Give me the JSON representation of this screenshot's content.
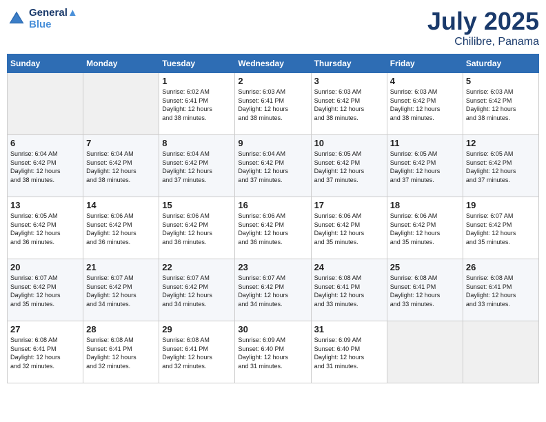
{
  "header": {
    "logo_line1": "General",
    "logo_line2": "Blue",
    "month": "July 2025",
    "location": "Chilibre, Panama"
  },
  "columns": [
    "Sunday",
    "Monday",
    "Tuesday",
    "Wednesday",
    "Thursday",
    "Friday",
    "Saturday"
  ],
  "weeks": [
    [
      {
        "day": "",
        "info": ""
      },
      {
        "day": "",
        "info": ""
      },
      {
        "day": "1",
        "info": "Sunrise: 6:02 AM\nSunset: 6:41 PM\nDaylight: 12 hours\nand 38 minutes."
      },
      {
        "day": "2",
        "info": "Sunrise: 6:03 AM\nSunset: 6:41 PM\nDaylight: 12 hours\nand 38 minutes."
      },
      {
        "day": "3",
        "info": "Sunrise: 6:03 AM\nSunset: 6:42 PM\nDaylight: 12 hours\nand 38 minutes."
      },
      {
        "day": "4",
        "info": "Sunrise: 6:03 AM\nSunset: 6:42 PM\nDaylight: 12 hours\nand 38 minutes."
      },
      {
        "day": "5",
        "info": "Sunrise: 6:03 AM\nSunset: 6:42 PM\nDaylight: 12 hours\nand 38 minutes."
      }
    ],
    [
      {
        "day": "6",
        "info": "Sunrise: 6:04 AM\nSunset: 6:42 PM\nDaylight: 12 hours\nand 38 minutes."
      },
      {
        "day": "7",
        "info": "Sunrise: 6:04 AM\nSunset: 6:42 PM\nDaylight: 12 hours\nand 38 minutes."
      },
      {
        "day": "8",
        "info": "Sunrise: 6:04 AM\nSunset: 6:42 PM\nDaylight: 12 hours\nand 37 minutes."
      },
      {
        "day": "9",
        "info": "Sunrise: 6:04 AM\nSunset: 6:42 PM\nDaylight: 12 hours\nand 37 minutes."
      },
      {
        "day": "10",
        "info": "Sunrise: 6:05 AM\nSunset: 6:42 PM\nDaylight: 12 hours\nand 37 minutes."
      },
      {
        "day": "11",
        "info": "Sunrise: 6:05 AM\nSunset: 6:42 PM\nDaylight: 12 hours\nand 37 minutes."
      },
      {
        "day": "12",
        "info": "Sunrise: 6:05 AM\nSunset: 6:42 PM\nDaylight: 12 hours\nand 37 minutes."
      }
    ],
    [
      {
        "day": "13",
        "info": "Sunrise: 6:05 AM\nSunset: 6:42 PM\nDaylight: 12 hours\nand 36 minutes."
      },
      {
        "day": "14",
        "info": "Sunrise: 6:06 AM\nSunset: 6:42 PM\nDaylight: 12 hours\nand 36 minutes."
      },
      {
        "day": "15",
        "info": "Sunrise: 6:06 AM\nSunset: 6:42 PM\nDaylight: 12 hours\nand 36 minutes."
      },
      {
        "day": "16",
        "info": "Sunrise: 6:06 AM\nSunset: 6:42 PM\nDaylight: 12 hours\nand 36 minutes."
      },
      {
        "day": "17",
        "info": "Sunrise: 6:06 AM\nSunset: 6:42 PM\nDaylight: 12 hours\nand 35 minutes."
      },
      {
        "day": "18",
        "info": "Sunrise: 6:06 AM\nSunset: 6:42 PM\nDaylight: 12 hours\nand 35 minutes."
      },
      {
        "day": "19",
        "info": "Sunrise: 6:07 AM\nSunset: 6:42 PM\nDaylight: 12 hours\nand 35 minutes."
      }
    ],
    [
      {
        "day": "20",
        "info": "Sunrise: 6:07 AM\nSunset: 6:42 PM\nDaylight: 12 hours\nand 35 minutes."
      },
      {
        "day": "21",
        "info": "Sunrise: 6:07 AM\nSunset: 6:42 PM\nDaylight: 12 hours\nand 34 minutes."
      },
      {
        "day": "22",
        "info": "Sunrise: 6:07 AM\nSunset: 6:42 PM\nDaylight: 12 hours\nand 34 minutes."
      },
      {
        "day": "23",
        "info": "Sunrise: 6:07 AM\nSunset: 6:42 PM\nDaylight: 12 hours\nand 34 minutes."
      },
      {
        "day": "24",
        "info": "Sunrise: 6:08 AM\nSunset: 6:41 PM\nDaylight: 12 hours\nand 33 minutes."
      },
      {
        "day": "25",
        "info": "Sunrise: 6:08 AM\nSunset: 6:41 PM\nDaylight: 12 hours\nand 33 minutes."
      },
      {
        "day": "26",
        "info": "Sunrise: 6:08 AM\nSunset: 6:41 PM\nDaylight: 12 hours\nand 33 minutes."
      }
    ],
    [
      {
        "day": "27",
        "info": "Sunrise: 6:08 AM\nSunset: 6:41 PM\nDaylight: 12 hours\nand 32 minutes."
      },
      {
        "day": "28",
        "info": "Sunrise: 6:08 AM\nSunset: 6:41 PM\nDaylight: 12 hours\nand 32 minutes."
      },
      {
        "day": "29",
        "info": "Sunrise: 6:08 AM\nSunset: 6:41 PM\nDaylight: 12 hours\nand 32 minutes."
      },
      {
        "day": "30",
        "info": "Sunrise: 6:09 AM\nSunset: 6:40 PM\nDaylight: 12 hours\nand 31 minutes."
      },
      {
        "day": "31",
        "info": "Sunrise: 6:09 AM\nSunset: 6:40 PM\nDaylight: 12 hours\nand 31 minutes."
      },
      {
        "day": "",
        "info": ""
      },
      {
        "day": "",
        "info": ""
      }
    ]
  ]
}
